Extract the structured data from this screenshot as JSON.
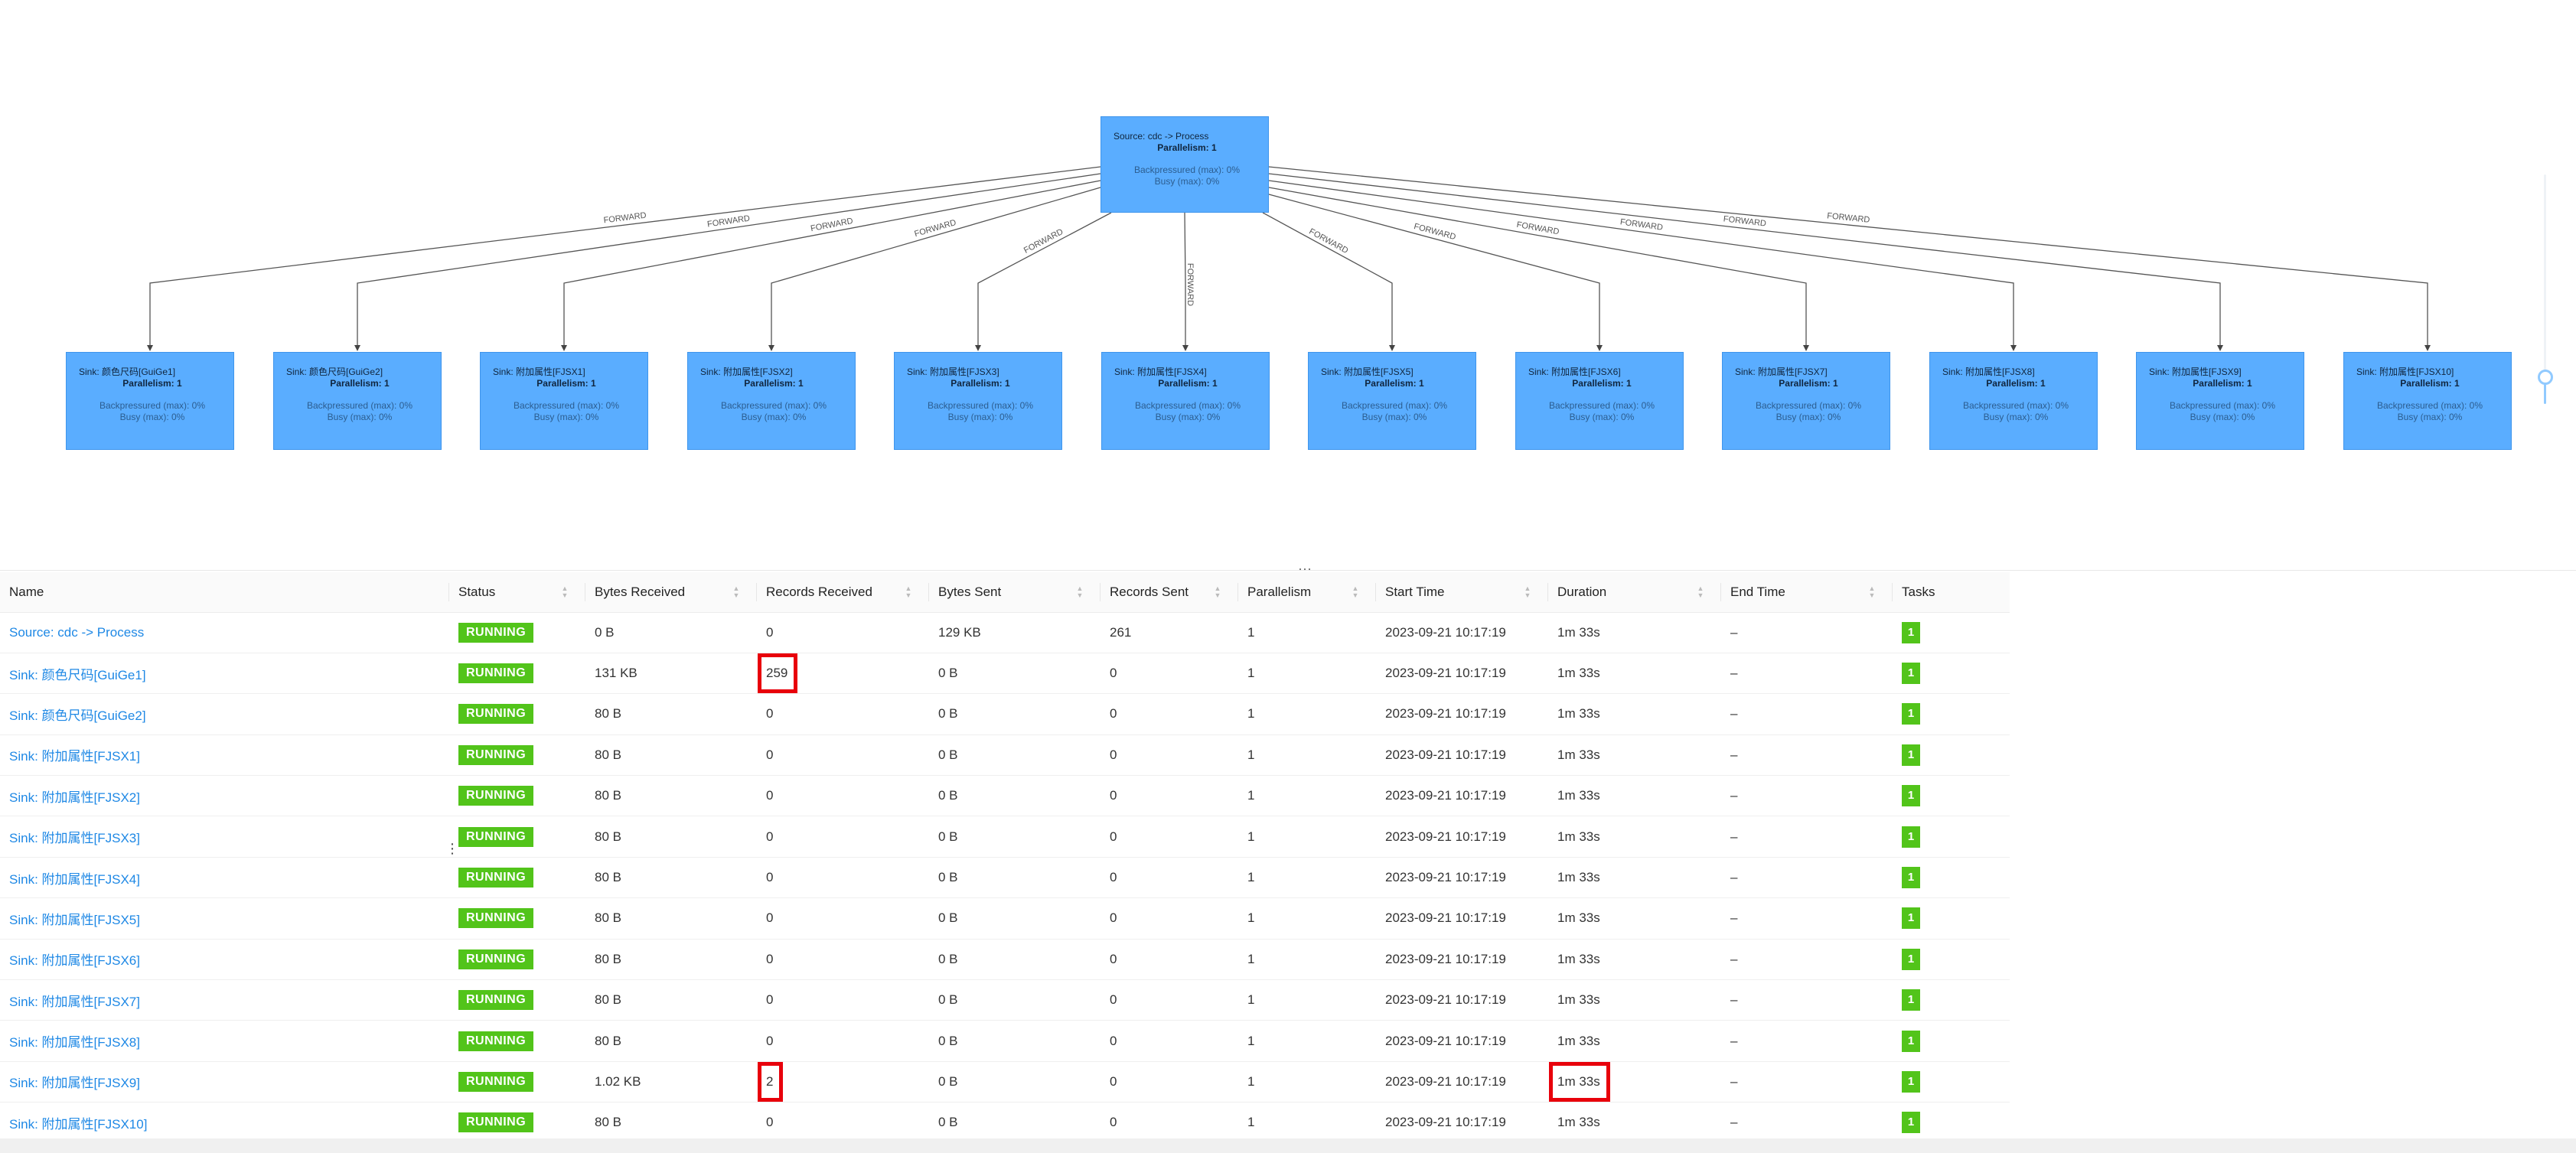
{
  "dag": {
    "source": {
      "title": "Source: cdc -> Process",
      "parallelism": "Parallelism: 1",
      "backpressured": "Backpressured (max): 0%",
      "busy": "Busy (max): 0%"
    },
    "sinks": [
      {
        "title": "Sink: 颜色尺码[GuiGe1]",
        "parallelism": "Parallelism: 1",
        "backpressured": "Backpressured (max): 0%",
        "busy": "Busy (max): 0%",
        "edge": "FORWARD"
      },
      {
        "title": "Sink: 颜色尺码[GuiGe2]",
        "parallelism": "Parallelism: 1",
        "backpressured": "Backpressured (max): 0%",
        "busy": "Busy (max): 0%",
        "edge": "FORWARD"
      },
      {
        "title": "Sink: 附加属性[FJSX1]",
        "parallelism": "Parallelism: 1",
        "backpressured": "Backpressured (max): 0%",
        "busy": "Busy (max): 0%",
        "edge": "FORWARD"
      },
      {
        "title": "Sink: 附加属性[FJSX2]",
        "parallelism": "Parallelism: 1",
        "backpressured": "Backpressured (max): 0%",
        "busy": "Busy (max): 0%",
        "edge": "FORWARD"
      },
      {
        "title": "Sink: 附加属性[FJSX3]",
        "parallelism": "Parallelism: 1",
        "backpressured": "Backpressured (max): 0%",
        "busy": "Busy (max): 0%",
        "edge": "FORWARD"
      },
      {
        "title": "Sink: 附加属性[FJSX4]",
        "parallelism": "Parallelism: 1",
        "backpressured": "Backpressured (max): 0%",
        "busy": "Busy (max): 0%",
        "edge": "FORWARD"
      },
      {
        "title": "Sink: 附加属性[FJSX5]",
        "parallelism": "Parallelism: 1",
        "backpressured": "Backpressured (max): 0%",
        "busy": "Busy (max): 0%",
        "edge": "FORWARD"
      },
      {
        "title": "Sink: 附加属性[FJSX6]",
        "parallelism": "Parallelism: 1",
        "backpressured": "Backpressured (max): 0%",
        "busy": "Busy (max): 0%",
        "edge": "FORWARD"
      },
      {
        "title": "Sink: 附加属性[FJSX7]",
        "parallelism": "Parallelism: 1",
        "backpressured": "Backpressured (max): 0%",
        "busy": "Busy (max): 0%",
        "edge": "FORWARD"
      },
      {
        "title": "Sink: 附加属性[FJSX8]",
        "parallelism": "Parallelism: 1",
        "backpressured": "Backpressured (max): 0%",
        "busy": "Busy (max): 0%",
        "edge": "FORWARD"
      },
      {
        "title": "Sink: 附加属性[FJSX9]",
        "parallelism": "Parallelism: 1",
        "backpressured": "Backpressured (max): 0%",
        "busy": "Busy (max): 0%",
        "edge": "FORWARD"
      },
      {
        "title": "Sink: 附加属性[FJSX10]",
        "parallelism": "Parallelism: 1",
        "backpressured": "Backpressured (max): 0%",
        "busy": "Busy (max): 0%",
        "edge": "FORWARD"
      }
    ],
    "split_handle": "···",
    "side_handle": "⋮"
  },
  "table": {
    "headers": [
      "Name",
      "Status",
      "Bytes Received",
      "Records Received",
      "Bytes Sent",
      "Records Sent",
      "Parallelism",
      "Start Time",
      "Duration",
      "End Time",
      "Tasks"
    ],
    "rows": [
      {
        "name": "Source: cdc -> Process",
        "status": "RUNNING",
        "bytes_received": "0 B",
        "records_received": "0",
        "bytes_sent": "129 KB",
        "records_sent": "261",
        "parallelism": "1",
        "start_time": "2023-09-21 10:17:19",
        "duration": "1m 33s",
        "end_time": "–",
        "tasks": "1"
      },
      {
        "name": "Sink: 颜色尺码[GuiGe1]",
        "status": "RUNNING",
        "bytes_received": "131 KB",
        "records_received": "259",
        "bytes_sent": "0 B",
        "records_sent": "0",
        "parallelism": "1",
        "start_time": "2023-09-21 10:17:19",
        "duration": "1m 33s",
        "end_time": "–",
        "tasks": "1"
      },
      {
        "name": "Sink: 颜色尺码[GuiGe2]",
        "status": "RUNNING",
        "bytes_received": "80 B",
        "records_received": "0",
        "bytes_sent": "0 B",
        "records_sent": "0",
        "parallelism": "1",
        "start_time": "2023-09-21 10:17:19",
        "duration": "1m 33s",
        "end_time": "–",
        "tasks": "1"
      },
      {
        "name": "Sink: 附加属性[FJSX1]",
        "status": "RUNNING",
        "bytes_received": "80 B",
        "records_received": "0",
        "bytes_sent": "0 B",
        "records_sent": "0",
        "parallelism": "1",
        "start_time": "2023-09-21 10:17:19",
        "duration": "1m 33s",
        "end_time": "–",
        "tasks": "1"
      },
      {
        "name": "Sink: 附加属性[FJSX2]",
        "status": "RUNNING",
        "bytes_received": "80 B",
        "records_received": "0",
        "bytes_sent": "0 B",
        "records_sent": "0",
        "parallelism": "1",
        "start_time": "2023-09-21 10:17:19",
        "duration": "1m 33s",
        "end_time": "–",
        "tasks": "1"
      },
      {
        "name": "Sink: 附加属性[FJSX3]",
        "status": "RUNNING",
        "bytes_received": "80 B",
        "records_received": "0",
        "bytes_sent": "0 B",
        "records_sent": "0",
        "parallelism": "1",
        "start_time": "2023-09-21 10:17:19",
        "duration": "1m 33s",
        "end_time": "–",
        "tasks": "1"
      },
      {
        "name": "Sink: 附加属性[FJSX4]",
        "status": "RUNNING",
        "bytes_received": "80 B",
        "records_received": "0",
        "bytes_sent": "0 B",
        "records_sent": "0",
        "parallelism": "1",
        "start_time": "2023-09-21 10:17:19",
        "duration": "1m 33s",
        "end_time": "–",
        "tasks": "1"
      },
      {
        "name": "Sink: 附加属性[FJSX5]",
        "status": "RUNNING",
        "bytes_received": "80 B",
        "records_received": "0",
        "bytes_sent": "0 B",
        "records_sent": "0",
        "parallelism": "1",
        "start_time": "2023-09-21 10:17:19",
        "duration": "1m 33s",
        "end_time": "–",
        "tasks": "1"
      },
      {
        "name": "Sink: 附加属性[FJSX6]",
        "status": "RUNNING",
        "bytes_received": "80 B",
        "records_received": "0",
        "bytes_sent": "0 B",
        "records_sent": "0",
        "parallelism": "1",
        "start_time": "2023-09-21 10:17:19",
        "duration": "1m 33s",
        "end_time": "–",
        "tasks": "1"
      },
      {
        "name": "Sink: 附加属性[FJSX7]",
        "status": "RUNNING",
        "bytes_received": "80 B",
        "records_received": "0",
        "bytes_sent": "0 B",
        "records_sent": "0",
        "parallelism": "1",
        "start_time": "2023-09-21 10:17:19",
        "duration": "1m 33s",
        "end_time": "–",
        "tasks": "1"
      },
      {
        "name": "Sink: 附加属性[FJSX8]",
        "status": "RUNNING",
        "bytes_received": "80 B",
        "records_received": "0",
        "bytes_sent": "0 B",
        "records_sent": "0",
        "parallelism": "1",
        "start_time": "2023-09-21 10:17:19",
        "duration": "1m 33s",
        "end_time": "–",
        "tasks": "1"
      },
      {
        "name": "Sink: 附加属性[FJSX9]",
        "status": "RUNNING",
        "bytes_received": "1.02 KB",
        "records_received": "2",
        "bytes_sent": "0 B",
        "records_sent": "0",
        "parallelism": "1",
        "start_time": "2023-09-21 10:17:19",
        "duration": "1m 33s",
        "end_time": "–",
        "tasks": "1"
      },
      {
        "name": "Sink: 附加属性[FJSX10]",
        "status": "RUNNING",
        "bytes_received": "80 B",
        "records_received": "0",
        "bytes_sent": "0 B",
        "records_sent": "0",
        "parallelism": "1",
        "start_time": "2023-09-21 10:17:19",
        "duration": "1m 33s",
        "end_time": "–",
        "tasks": "1"
      }
    ],
    "highlighted": [
      {
        "row": 1,
        "column": "records_received"
      },
      {
        "row": 11,
        "column": "records_received"
      },
      {
        "row": 11,
        "column": "duration"
      }
    ]
  },
  "colors": {
    "node_fill": "#5aadff",
    "running_badge": "#52c41a",
    "link": "#1e88e5",
    "highlight_box": "#e8000b"
  }
}
